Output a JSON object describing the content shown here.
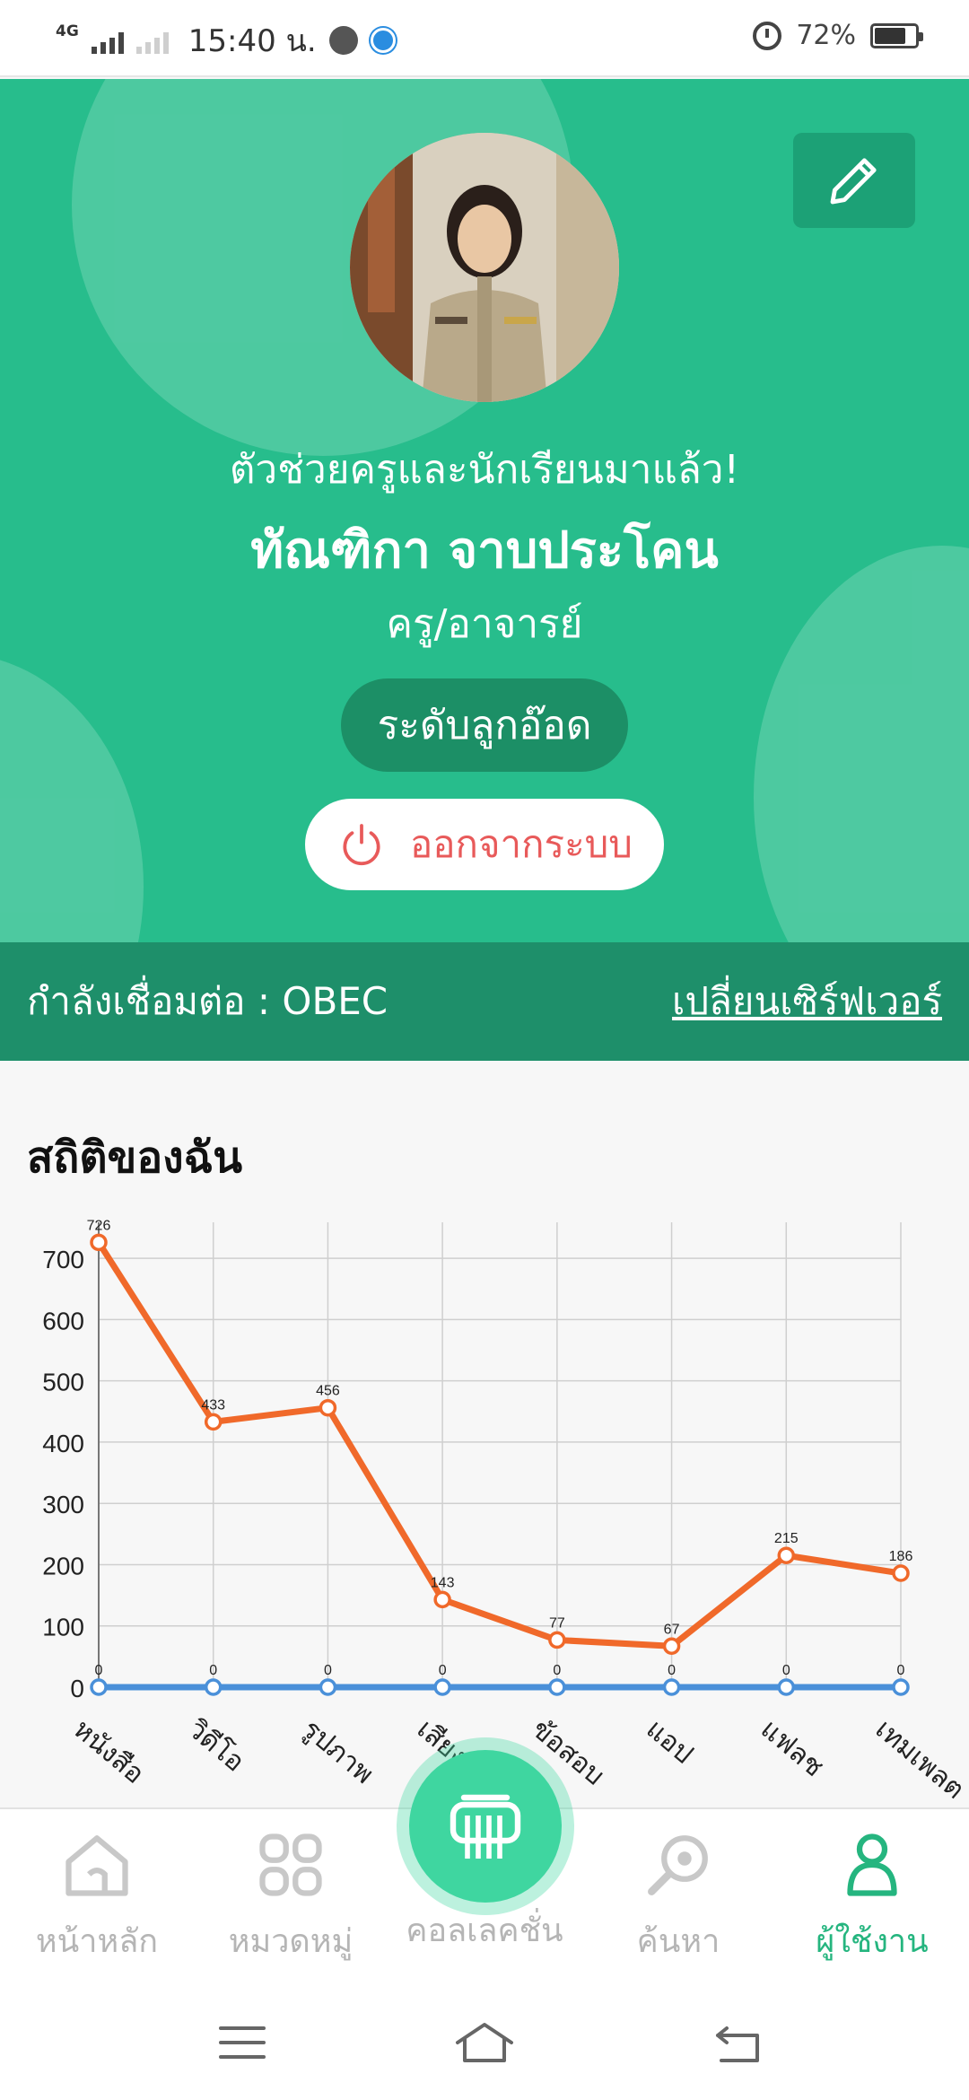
{
  "status_bar": {
    "network": "4G",
    "time": "15:40 น.",
    "battery": "72%"
  },
  "profile": {
    "greeting": "ตัวช่วยครูและนักเรียนมาแล้ว!",
    "name": "ทัณฑิกา จาบประโคน",
    "role": "ครู/อาจารย์",
    "level": "ระดับลูกอ๊อด",
    "logout_label": "ออกจากระบบ"
  },
  "server": {
    "status_label": "กำลังเชื่อมต่อ : OBEC",
    "change_label": "เปลี่ยนเซิร์ฟเวอร์"
  },
  "stats": {
    "title": "สถิติของฉัน"
  },
  "chart_data": {
    "type": "line",
    "categories": [
      "หนังสือ",
      "วิดีโอ",
      "รูปภาพ",
      "เสียง",
      "ข้อสอบ",
      "แอป",
      "แฟลช",
      "เทมเพลต"
    ],
    "series": [
      {
        "values": [
          726,
          433,
          456,
          143,
          77,
          67,
          215,
          186
        ],
        "color": "#f0692a"
      },
      {
        "values": [
          0,
          0,
          0,
          0,
          0,
          0,
          0,
          0
        ],
        "color": "#4a90d9"
      }
    ],
    "y_ticks": [
      0,
      100,
      200,
      300,
      400,
      500,
      600,
      700
    ],
    "ylim": [
      0,
      750
    ],
    "grid": true,
    "xlabel": "",
    "ylabel": ""
  },
  "bottom_nav": {
    "items": [
      {
        "label": "หน้าหลัก",
        "icon": "home-icon"
      },
      {
        "label": "หมวดหมู่",
        "icon": "category-icon"
      },
      {
        "label": "คอลเลคชั่น",
        "icon": "collection-icon"
      },
      {
        "label": "ค้นหา",
        "icon": "search-icon"
      },
      {
        "label": "ผู้ใช้งาน",
        "icon": "user-icon"
      }
    ],
    "active_index": 4
  },
  "colors": {
    "header": "#27bd8c",
    "accent": "#25b57f",
    "logout": "#e85a5a"
  }
}
